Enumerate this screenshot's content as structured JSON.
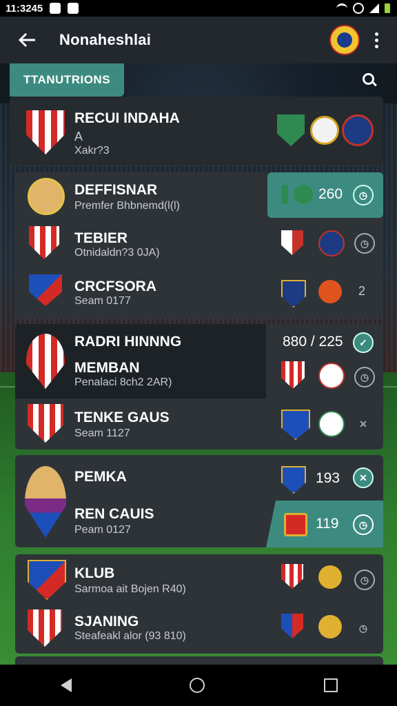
{
  "status_bar": {
    "time": "11:3245"
  },
  "app_bar": {
    "title": "Nonaheshlai"
  },
  "tab": {
    "label": "TTANUTRIONS"
  },
  "groups": [
    {
      "name": "RECUI INDAHA",
      "line2": "A",
      "line3": "Xakr?3"
    },
    {
      "name": "DEFFISNAR",
      "subtitle": "Premfer Bhbnemd(l(l)",
      "score": "260"
    },
    {
      "name": "TEBIER",
      "subtitle": "Otnidaldn?3 0JA)"
    },
    {
      "name": "CRCFSORA",
      "subtitle": "Seam 0177",
      "action": "2"
    },
    {
      "name": "RADRI HINNNG",
      "score": "880 / 225"
    },
    {
      "name": "MEMBAN",
      "subtitle": "Penalaci 8ch2 2AR)"
    },
    {
      "name": "TENKE GAUS",
      "subtitle": "Seam 1127"
    },
    {
      "name": "PEMKA",
      "score": "193"
    },
    {
      "name": "REN CAUIS",
      "subtitle": "Peam 0127",
      "score": "119"
    },
    {
      "name": "KLUB",
      "subtitle": "Sarmoa ait Bojen R40)"
    },
    {
      "name": "SJANING",
      "subtitle": "Steafeakl alor (93 810)"
    }
  ]
}
